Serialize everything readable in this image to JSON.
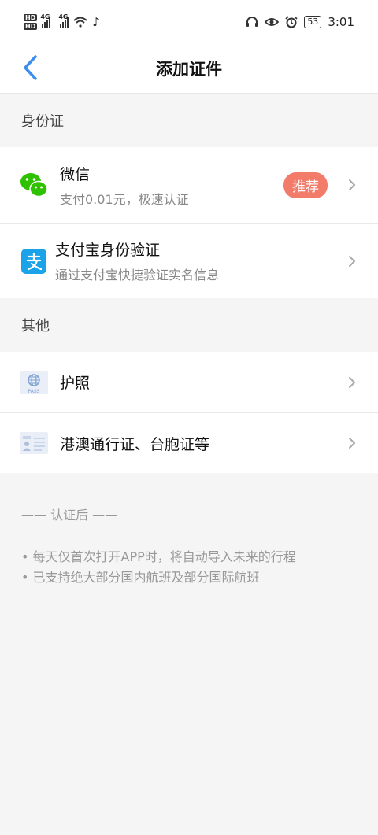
{
  "status_bar": {
    "time": "3:01",
    "battery": "53",
    "network_left": "4G",
    "network_right": "4G",
    "hd_label": "HD"
  },
  "nav": {
    "title": "添加证件"
  },
  "sections": {
    "id_card_header": "身份证",
    "other_header": "其他"
  },
  "items": {
    "wechat": {
      "title": "微信",
      "subtitle": "支付0.01元，极速认证",
      "badge": "推荐"
    },
    "alipay": {
      "title": "支付宝身份验证",
      "subtitle": "通过支付宝快捷验证实名信息"
    },
    "passport": {
      "title": "护照",
      "icon_text": "PASS"
    },
    "hk_macau": {
      "title": "港澳通行证、台胞证等"
    }
  },
  "footer": {
    "title": "—— 认证后 ——",
    "notes": [
      "• 每天仅首次打开APP时，将自动导入未来的行程",
      "• 已支持绝大部分国内航班及部分国际航班"
    ]
  },
  "colors": {
    "accent": "#3d8ef0",
    "badge": "#f37b6a",
    "wechat": "#2dc100",
    "alipay": "#1aa3e8"
  }
}
